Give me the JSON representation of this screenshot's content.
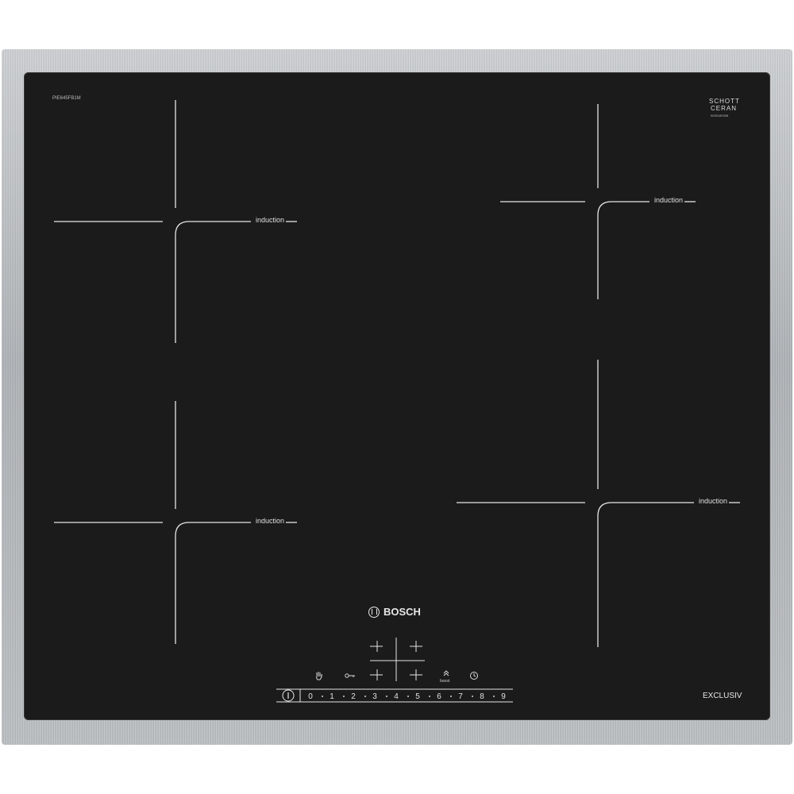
{
  "hob": {
    "model": "PIE645FB1M",
    "glass_brand_line1": "SCHOTT",
    "glass_brand_line2": "CERAN",
    "glass_serial": "9000189338",
    "brand": "BOSCH",
    "series": "EXCLUSIV"
  },
  "zones": {
    "front_left_label": "induction",
    "front_right_label": "induction",
    "rear_left_label": "induction",
    "rear_right_label": "induction"
  },
  "controls": {
    "power_symbol": "⏽",
    "child_lock_icon": "hand-icon",
    "wipe_protect_icon": "key-icon",
    "boost_label": "boost",
    "timer_icon": "clock-icon",
    "power_levels": [
      "0",
      "1",
      "2",
      "3",
      "4",
      "5",
      "6",
      "7",
      "8",
      "9"
    ]
  }
}
